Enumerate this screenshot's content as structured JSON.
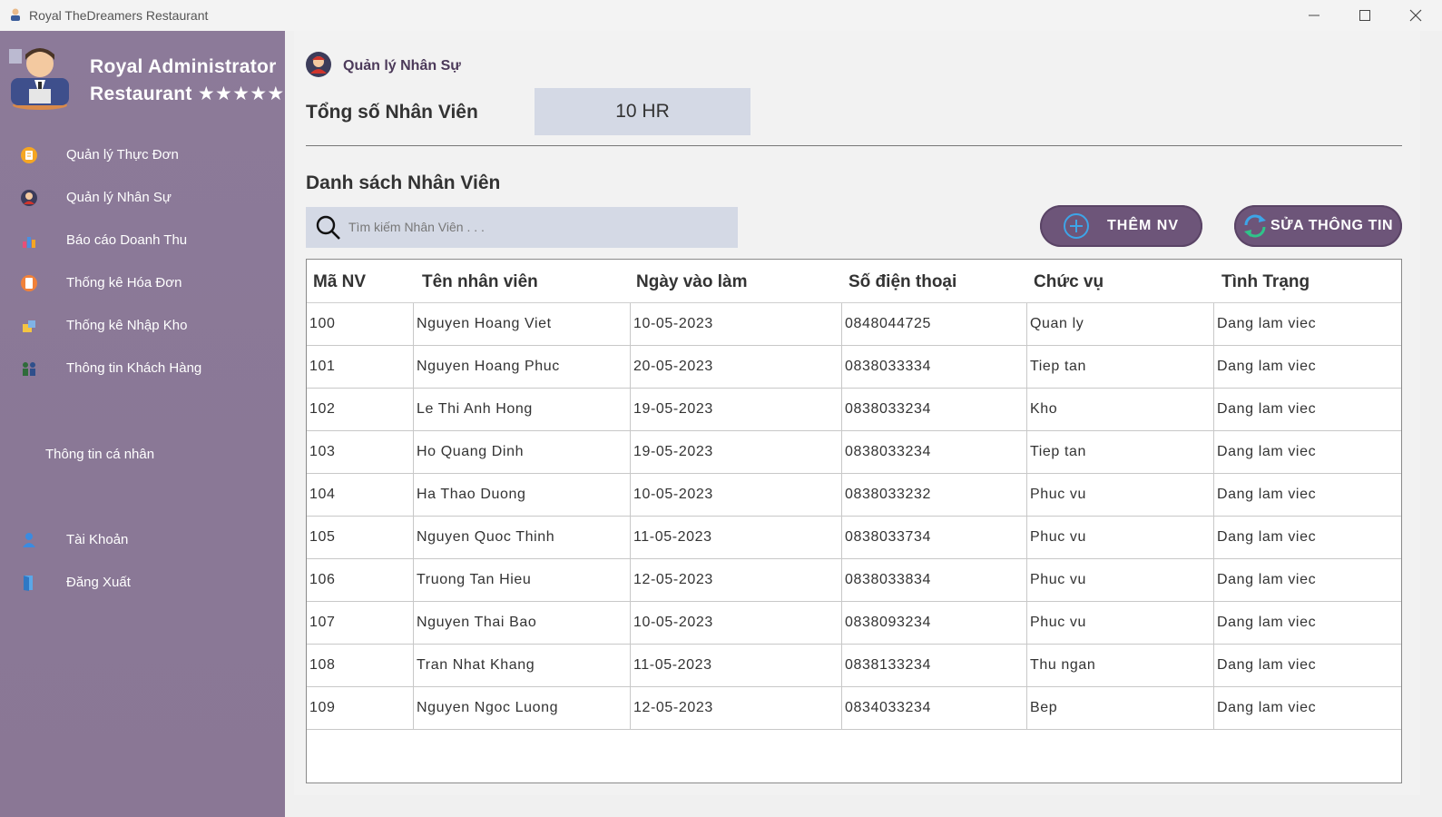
{
  "window": {
    "title": "Royal TheDreamers Restaurant"
  },
  "brand": {
    "line1": "Royal Administrator",
    "line2": "Restaurant ★★★★★"
  },
  "sidebar": {
    "items": [
      {
        "label": "Quản lý Thực Đơn",
        "icon": "menu-icon"
      },
      {
        "label": "Quản lý Nhân Sự",
        "icon": "staff-icon"
      },
      {
        "label": "Báo cáo Doanh Thu",
        "icon": "revenue-chart-icon"
      },
      {
        "label": "Thống kê Hóa Đơn",
        "icon": "invoice-icon"
      },
      {
        "label": "Thống kê Nhập Kho",
        "icon": "warehouse-icon"
      },
      {
        "label": "Thông tin Khách Hàng",
        "icon": "customers-icon"
      }
    ],
    "section_label": "Thông tin cá nhân",
    "account_items": [
      {
        "label": "Tài Khoản",
        "icon": "user-icon"
      },
      {
        "label": "Đăng Xuất",
        "icon": "logout-icon"
      }
    ]
  },
  "main": {
    "header_title": "Quản lý Nhân Sự",
    "total_label": "Tổng số Nhân Viên",
    "total_value": "10 HR",
    "list_title": "Danh sách Nhân Viên",
    "search_placeholder": "Tìm kiếm Nhân Viên . . .",
    "add_button": "THÊM NV",
    "edit_button": "SỬA THÔNG TIN"
  },
  "table": {
    "columns": [
      "Mã NV",
      "Tên nhân viên",
      "Ngày vào làm",
      "Số điện thoại",
      "Chức vụ",
      "Tình Trạng"
    ],
    "rows": [
      [
        "100",
        "Nguyen Hoang Viet",
        "10-05-2023",
        "0848044725",
        "Quan ly",
        "Dang lam viec"
      ],
      [
        "101",
        "Nguyen Hoang Phuc",
        "20-05-2023",
        "0838033334",
        "Tiep tan",
        "Dang lam viec"
      ],
      [
        "102",
        "Le Thi Anh Hong",
        "19-05-2023",
        "0838033234",
        "Kho",
        "Dang lam viec"
      ],
      [
        "103",
        "Ho Quang Dinh",
        "19-05-2023",
        "0838033234",
        "Tiep tan",
        "Dang lam viec"
      ],
      [
        "104",
        "Ha Thao Duong",
        "10-05-2023",
        "0838033232",
        "Phuc vu",
        "Dang lam viec"
      ],
      [
        "105",
        "Nguyen Quoc Thinh",
        "11-05-2023",
        "0838033734",
        "Phuc vu",
        "Dang lam viec"
      ],
      [
        "106",
        "Truong Tan Hieu",
        "12-05-2023",
        "0838033834",
        "Phuc vu",
        "Dang lam viec"
      ],
      [
        "107",
        "Nguyen Thai Bao",
        "10-05-2023",
        "0838093234",
        "Phuc vu",
        "Dang lam viec"
      ],
      [
        "108",
        "Tran Nhat Khang",
        "11-05-2023",
        "0838133234",
        "Thu ngan",
        "Dang lam viec"
      ],
      [
        "109",
        "Nguyen Ngoc Luong",
        "12-05-2023",
        "0834033234",
        "Bep",
        "Dang lam viec"
      ]
    ]
  },
  "colors": {
    "sidebar": "#8a7896",
    "accent": "#6d5579",
    "input_bg": "#d4d9e5"
  }
}
